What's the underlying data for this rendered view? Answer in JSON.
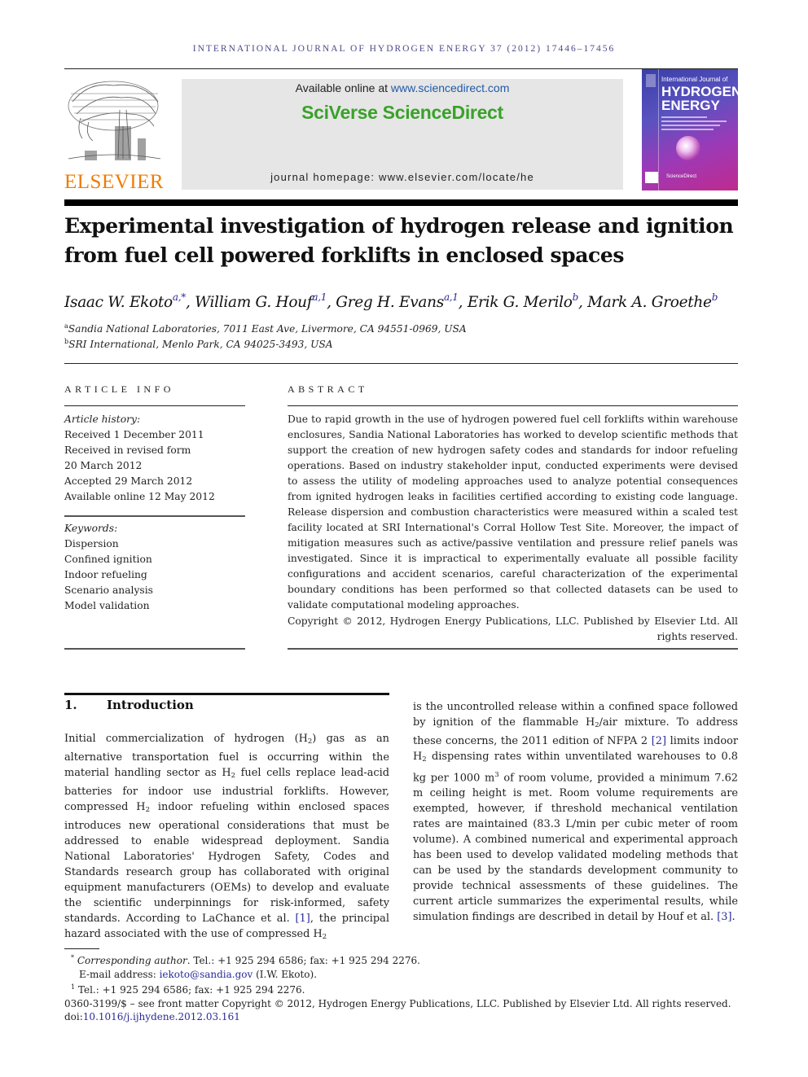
{
  "running_head": "INTERNATIONAL JOURNAL OF HYDROGEN ENERGY 37 (2012) 17446–17456",
  "masthead": {
    "publisher_logo_text": "ELSEVIER",
    "available_prefix": "Available online at ",
    "available_link": "www.sciencedirect.com",
    "brand": "SciVerse ScienceDirect",
    "homepage": "journal homepage: www.elsevier.com/locate/he",
    "cover": {
      "small_line": "International Journal of",
      "big_line_1": "HYDROGEN",
      "big_line_2": "ENERGY",
      "footer_text": "ScienceDirect"
    },
    "brand_color": "#3aa12a",
    "publisher_color": "#f07c00"
  },
  "article": {
    "title_line_1": "Experimental investigation of hydrogen release and ignition",
    "title_line_2": "from fuel cell powered forklifts in enclosed spaces",
    "authors": [
      {
        "name": "Isaac W. Ekoto",
        "marks": "a,*"
      },
      {
        "name": "William G. Houf",
        "marks": "a,1"
      },
      {
        "name": "Greg H. Evans",
        "marks": "a,1"
      },
      {
        "name": "Erik G. Merilo",
        "marks": "b"
      },
      {
        "name": "Mark A. Groethe",
        "marks": "b"
      }
    ],
    "separator": ", ",
    "affiliations": [
      {
        "mark": "a",
        "text": "Sandia National Laboratories, 7011 East Ave, Livermore, CA 94551-0969, USA"
      },
      {
        "mark": "b",
        "text": "SRI International, Menlo Park, CA 94025-3493, USA"
      }
    ]
  },
  "article_info": {
    "heading": "ARTICLE INFO",
    "history_label": "Article history:",
    "history": [
      "Received 1 December 2011",
      "Received in revised form",
      "20 March 2012",
      "Accepted 29 March 2012",
      "Available online 12 May 2012"
    ],
    "keywords_label": "Keywords:",
    "keywords": [
      "Dispersion",
      "Confined ignition",
      "Indoor refueling",
      "Scenario analysis",
      "Model validation"
    ]
  },
  "abstract": {
    "heading": "ABSTRACT",
    "text": "Due to rapid growth in the use of hydrogen powered fuel cell forklifts within warehouse enclosures, Sandia National Laboratories has worked to develop scientific methods that support the creation of new hydrogen safety codes and standards for indoor refueling operations. Based on industry stakeholder input, conducted experiments were devised to assess the utility of modeling approaches used to analyze potential consequences from ignited hydrogen leaks in facilities certified according to existing code language. Release dispersion and combustion characteristics were measured within a scaled test facility located at SRI International's Corral Hollow Test Site. Moreover, the impact of mitigation measures such as active/passive ventilation and pressure relief panels was investigated. Since it is impractical to experimentally evaluate all possible facility configurations and accident scenarios, careful characterization of the experimental boundary conditions has been performed so that collected datasets can be used to validate computational modeling approaches.",
    "copyright": "Copyright © 2012, Hydrogen Energy Publications, LLC. Published by Elsevier Ltd. All rights reserved."
  },
  "introduction": {
    "number": "1.",
    "heading": "Introduction",
    "left": {
      "p1": "Initial commercialization of hydrogen (H",
      "p2": ") gas as an alternative transportation fuel is occurring within the material handling sector as H",
      "p3": " fuel cells replace lead-acid batteries for indoor use industrial forklifts. However, compressed H",
      "p4": " indoor refueling within enclosed spaces introduces new operational considerations that must be addressed to enable widespread deployment. Sandia National Laboratories' Hydrogen Safety, Codes and Standards research group has collaborated with original equipment manufacturers (OEMs) to develop and evaluate the scientific underpinnings for risk-informed, safety standards. According to LaChance et al. ",
      "ref1": "[1]",
      "p5": ", the principal hazard associated with the use of compressed H",
      "sub": "2"
    },
    "right": {
      "p1": "is the uncontrolled release within a confined space followed by ignition of the flammable H",
      "p2": "/air mixture. To address these concerns, the 2011 edition of NFPA 2 ",
      "ref2": "[2]",
      "p3": " limits indoor H",
      "p4": " dispensing rates within unventilated warehouses to 0.8 kg per 1000 m",
      "sup3": "3",
      "p5": " of room volume, provided a minimum 7.62 m ceiling height is met. Room volume requirements are exempted, however, if threshold mechanical ventilation rates are maintained (83.3 L/min per cubic meter of room volume). A combined numerical and experimental approach has been used to develop validated modeling methods that can be used by the standards development community to provide technical assessments of these guidelines. The current article summarizes the experimental results, while simulation findings are described in detail by Houf et al. ",
      "ref3": "[3]",
      "p6": "."
    }
  },
  "footnotes": {
    "corresponding_mark": "*",
    "corresponding_label": "Corresponding author",
    "corresponding_contact": ". Tel.: +1 925 294 6586; fax: +1 925 294 2276.",
    "email_label": "E-mail address: ",
    "email": "iekoto@sandia.gov",
    "email_suffix": " (I.W. Ekoto).",
    "note1_mark": "1",
    "note1": " Tel.: +1 925 294 6586; fax: +1 925 294 2276.",
    "front_matter": "0360-3199/$ – see front matter Copyright © 2012, Hydrogen Energy Publications, LLC. Published by Elsevier Ltd. All rights reserved.",
    "doi_label": "doi:",
    "doi": "10.1016/j.ijhydene.2012.03.161"
  }
}
